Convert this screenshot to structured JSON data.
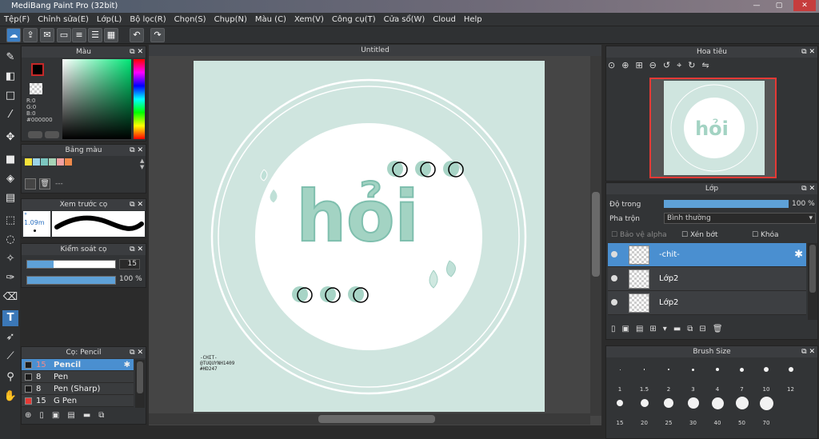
{
  "window": {
    "title": "MediBang Paint Pro (32bit)"
  },
  "menu": [
    "Tệp(F)",
    "Chỉnh sửa(E)",
    "Lớp(L)",
    "Bộ lọc(R)",
    "Chọn(S)",
    "Chụp(N)",
    "Màu (C)",
    "Xem(V)",
    "Công cụ(T)",
    "Cửa sổ(W)",
    "Cloud",
    "Help"
  ],
  "color_panel": {
    "title": "Màu",
    "r": "R:0",
    "g": "G:0",
    "b": "B:0",
    "hex": "#000000",
    "fg": "#000000",
    "bg": "#ffffff"
  },
  "palette_panel": {
    "title": "Bảng màu",
    "swatches": [
      "#f4e23a",
      "#9ad3e8",
      "#7cc7c0",
      "#a7d3b7",
      "#f2a1a1",
      "#f08a4b"
    ],
    "footer": "---"
  },
  "brush_preview": {
    "title": "Xem trước cọ",
    "size": "1.09m"
  },
  "brush_control": {
    "title": "Kiểm soát cọ",
    "size_value": "15",
    "opacity_value": "100",
    "opacity_unit": "%"
  },
  "brush_list": {
    "title": "Cọ: Pencil",
    "items": [
      {
        "size": "15",
        "name": "Pencil",
        "active": true,
        "color": "#1b1b1b"
      },
      {
        "size": "8",
        "name": "Pen",
        "active": false,
        "color": "#1b1b1b"
      },
      {
        "size": "8",
        "name": "Pen (Sharp)",
        "active": false,
        "color": "#1b1b1b"
      },
      {
        "size": "15",
        "name": "G Pen",
        "active": false,
        "color": "#e53935"
      }
    ]
  },
  "canvas": {
    "tab": "Untitled",
    "art_text": "hỏi",
    "sign": [
      "-CHIT-",
      "@TUQUYNH1409",
      "#HD247"
    ]
  },
  "navigator": {
    "title": "Hoa tiêu"
  },
  "layer_panel": {
    "title": "Lớp",
    "opacity_label": "Độ trong",
    "opacity_value": "100",
    "opacity_unit": "%",
    "blend_label": "Pha trộn",
    "blend_value": "Bình thường",
    "protect_alpha": "Bảo vệ alpha",
    "clipping": "Xén bớt",
    "lock": "Khóa",
    "layers": [
      {
        "name": "-chit-",
        "active": true
      },
      {
        "name": "Lớp2",
        "active": false
      },
      {
        "name": "Lớp2",
        "active": false
      }
    ]
  },
  "brush_size": {
    "title": "Brush Size",
    "sizes": [
      "1",
      "1.5",
      "2",
      "3",
      "4",
      "7",
      "10",
      "12",
      "15",
      "20",
      "25",
      "30",
      "40",
      "50",
      "70"
    ]
  }
}
